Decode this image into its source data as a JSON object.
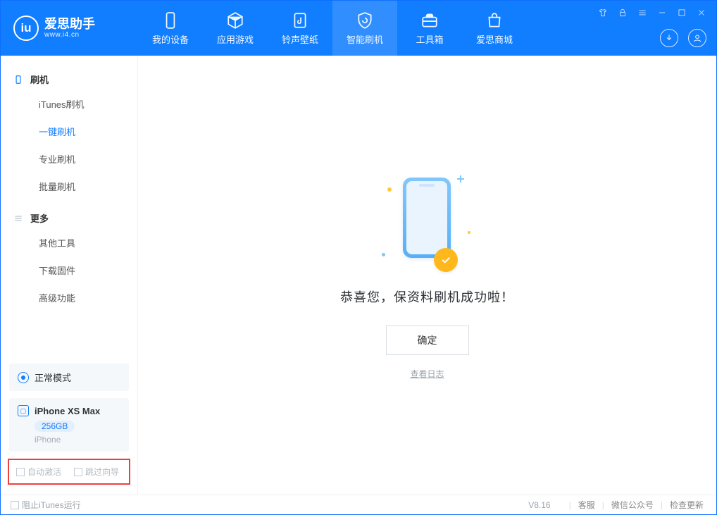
{
  "brand": {
    "name": "爱思助手",
    "url": "www.i4.cn"
  },
  "nav": {
    "device": "我的设备",
    "apps": "应用游戏",
    "ringtone": "铃声壁纸",
    "flash": "智能刷机",
    "toolbox": "工具箱",
    "store": "爱思商城"
  },
  "sidebar": {
    "sec1_title": "刷机",
    "sec1": {
      "itunes": "iTunes刷机",
      "onekey": "一键刷机",
      "pro": "专业刷机",
      "batch": "批量刷机"
    },
    "sec2_title": "更多",
    "sec2": {
      "other": "其他工具",
      "firmware": "下载固件",
      "advanced": "高级功能"
    }
  },
  "mode": {
    "label": "正常模式"
  },
  "device": {
    "name": "iPhone XS Max",
    "capacity": "256GB",
    "model": "iPhone"
  },
  "options": {
    "auto_activate": "自动激活",
    "skip_guide": "跳过向导"
  },
  "result": {
    "message": "恭喜您，保资料刷机成功啦！",
    "ok": "确定",
    "view_log": "查看日志"
  },
  "footer": {
    "block_itunes": "阻止iTunes运行",
    "version": "V8.16",
    "support": "客服",
    "wechat": "微信公众号",
    "update": "检查更新"
  }
}
